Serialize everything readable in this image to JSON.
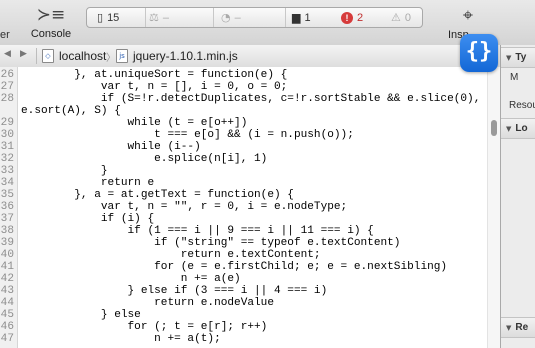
{
  "toolbar": {
    "left_cut_label": "er",
    "console_label": "Console",
    "console_icon": "console-icon",
    "inspect_label": "Insp",
    "inspect_icon": "crosshair-icon",
    "activity": {
      "resources_count": "15",
      "errors_count": "1",
      "issues_count": "2",
      "warnings_count": "0"
    }
  },
  "breadcrumb": {
    "host": "localhost",
    "file": "jquery-1.10.1.min.js"
  },
  "code": {
    "first_line_number": 26,
    "lines": [
      {
        "n": "26",
        "t": "        }, at.uniqueSort = function(e) {"
      },
      {
        "n": "27",
        "t": "            var t, n = [], i = 0, o = 0;"
      },
      {
        "n": "28",
        "t": "            if (S=!r.detectDuplicates, c=!r.sortStable && e.slice(0),"
      },
      {
        "n": "",
        "t": "e.sort(A), S) {"
      },
      {
        "n": "29",
        "t": "                while (t = e[o++])"
      },
      {
        "n": "30",
        "t": "                    t === e[o] && (i = n.push(o));"
      },
      {
        "n": "31",
        "t": "                while (i--)"
      },
      {
        "n": "32",
        "t": "                    e.splice(n[i], 1)"
      },
      {
        "n": "33",
        "t": "            }"
      },
      {
        "n": "34",
        "t": "            return e"
      },
      {
        "n": "35",
        "t": "        }, a = at.getText = function(e) {"
      },
      {
        "n": "36",
        "t": "            var t, n = \"\", r = 0, i = e.nodeType;"
      },
      {
        "n": "37",
        "t": "            if (i) {"
      },
      {
        "n": "38",
        "t": "                if (1 === i || 9 === i || 11 === i) {"
      },
      {
        "n": "39",
        "t": "                    if (\"string\" == typeof e.textContent)"
      },
      {
        "n": "40",
        "t": "                        return e.textContent;"
      },
      {
        "n": "41",
        "t": "                    for (e = e.firstChild; e; e = e.nextSibling)"
      },
      {
        "n": "42",
        "t": "                        n += a(e)"
      },
      {
        "n": "43",
        "t": "                } else if (3 === i || 4 === i)"
      },
      {
        "n": "44",
        "t": "                    return e.nodeValue"
      },
      {
        "n": "45",
        "t": "            } else"
      },
      {
        "n": "46",
        "t": "                for (; t = e[r]; r++)"
      },
      {
        "n": "47",
        "t": "                    n += a(t);"
      }
    ]
  },
  "sidebar": {
    "sections": [
      {
        "label": "Ty"
      },
      {
        "label": "Lo"
      },
      {
        "label": "Re"
      }
    ],
    "rows": [
      "M",
      "Resou"
    ]
  },
  "badge_glyph": "{}",
  "colors": {
    "accent_blue": "#1c6fe0",
    "error_red": "#d63b3b"
  }
}
